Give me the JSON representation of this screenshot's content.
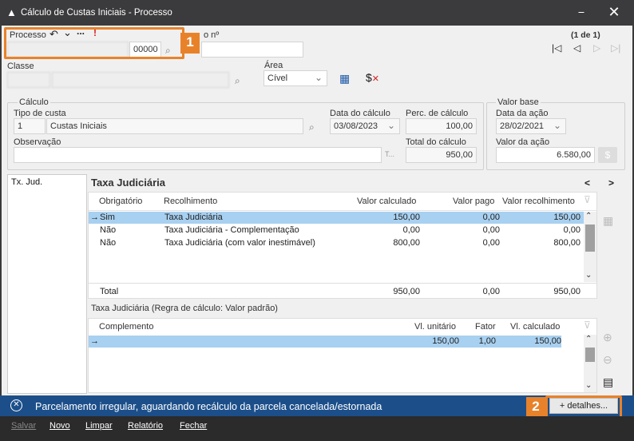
{
  "window": {
    "title": "Cálculo de Custas Iniciais - Processo",
    "minimize_glyph": "⎯",
    "close_glyph": "✕"
  },
  "processo": {
    "label": "Processo",
    "suffix": "00000",
    "undo_icon": "↶",
    "dropdown_icon": "⌄",
    "more_icon": "...",
    "alert_icon": "!"
  },
  "calculo_no": {
    "label": "o nº"
  },
  "pagination": {
    "text": "(1 de 1)"
  },
  "classe": {
    "label": "Classe"
  },
  "area": {
    "label": "Área",
    "value": "Cível"
  },
  "calculo_group": {
    "label": "Cálculo",
    "tipo_custa_label": "Tipo de custa",
    "tipo_custa_code": "1",
    "tipo_custa_value": "Custas Iniciais",
    "data_calculo_label": "Data do cálculo",
    "data_calculo_value": "03/08/2023",
    "perc_label": "Perc. de cálculo",
    "perc_value": "100,00",
    "observacao_label": "Observação",
    "observacao_ellipsis": "T...",
    "total_label": "Total do cálculo",
    "total_value": "950,00"
  },
  "valor_base_group": {
    "label": "Valor base",
    "data_acao_label": "Data da ação",
    "data_acao_value": "28/02/2021",
    "valor_acao_label": "Valor da ação",
    "valor_acao_value": "6.580,00"
  },
  "left_list": {
    "item": "Tx. Jud."
  },
  "taxa": {
    "title": "Taxa Judiciária",
    "nav_prev": "<",
    "nav_next": ">",
    "headers": {
      "obrigatorio": "Obrigatório",
      "recolhimento": "Recolhimento",
      "valor_calculado": "Valor calculado",
      "valor_pago": "Valor pago",
      "valor_recolhimento": "Valor recolhimento"
    },
    "rows": [
      {
        "obrigatorio": "Sim",
        "recolhimento": "Taxa Judiciária",
        "valor_calculado": "150,00",
        "valor_pago": "0,00",
        "valor_recolhimento": "150,00"
      },
      {
        "obrigatorio": "Não",
        "recolhimento": "Taxa Judiciária - Complementação",
        "valor_calculado": "0,00",
        "valor_pago": "0,00",
        "valor_recolhimento": "0,00"
      },
      {
        "obrigatorio": "Não",
        "recolhimento": "Taxa Judiciária (com valor inestimável)",
        "valor_calculado": "800,00",
        "valor_pago": "0,00",
        "valor_recolhimento": "800,00"
      }
    ],
    "total_label": "Total",
    "total_calculado": "950,00",
    "total_pago": "0,00",
    "total_recolhimento": "950,00"
  },
  "regra": {
    "label": "Taxa Judiciária (Regra de cálculo: Valor padrão)"
  },
  "complemento": {
    "headers": {
      "complemento": "Complemento",
      "vl_unitario": "Vl. unitário",
      "fator": "Fator",
      "vl_calculado": "Vl. calculado"
    },
    "rows": [
      {
        "vl_unitario": "150,00",
        "fator": "1,00",
        "vl_calculado": "150,00"
      }
    ]
  },
  "status": {
    "message": "Parcelamento irregular, aguardando recálculo da parcela cancelada/estornada",
    "details_button": "+ detalhes..."
  },
  "footer": {
    "salvar": "Salvar",
    "novo": "Novo",
    "limpar": "Limpar",
    "relatorio": "Relatório",
    "fechar": "Fechar"
  },
  "callouts": {
    "one": "1",
    "two": "2"
  },
  "colors": {
    "accent": "#e8822a",
    "status_bg": "#1c4f8a",
    "selected_row": "#a8d0f0"
  }
}
